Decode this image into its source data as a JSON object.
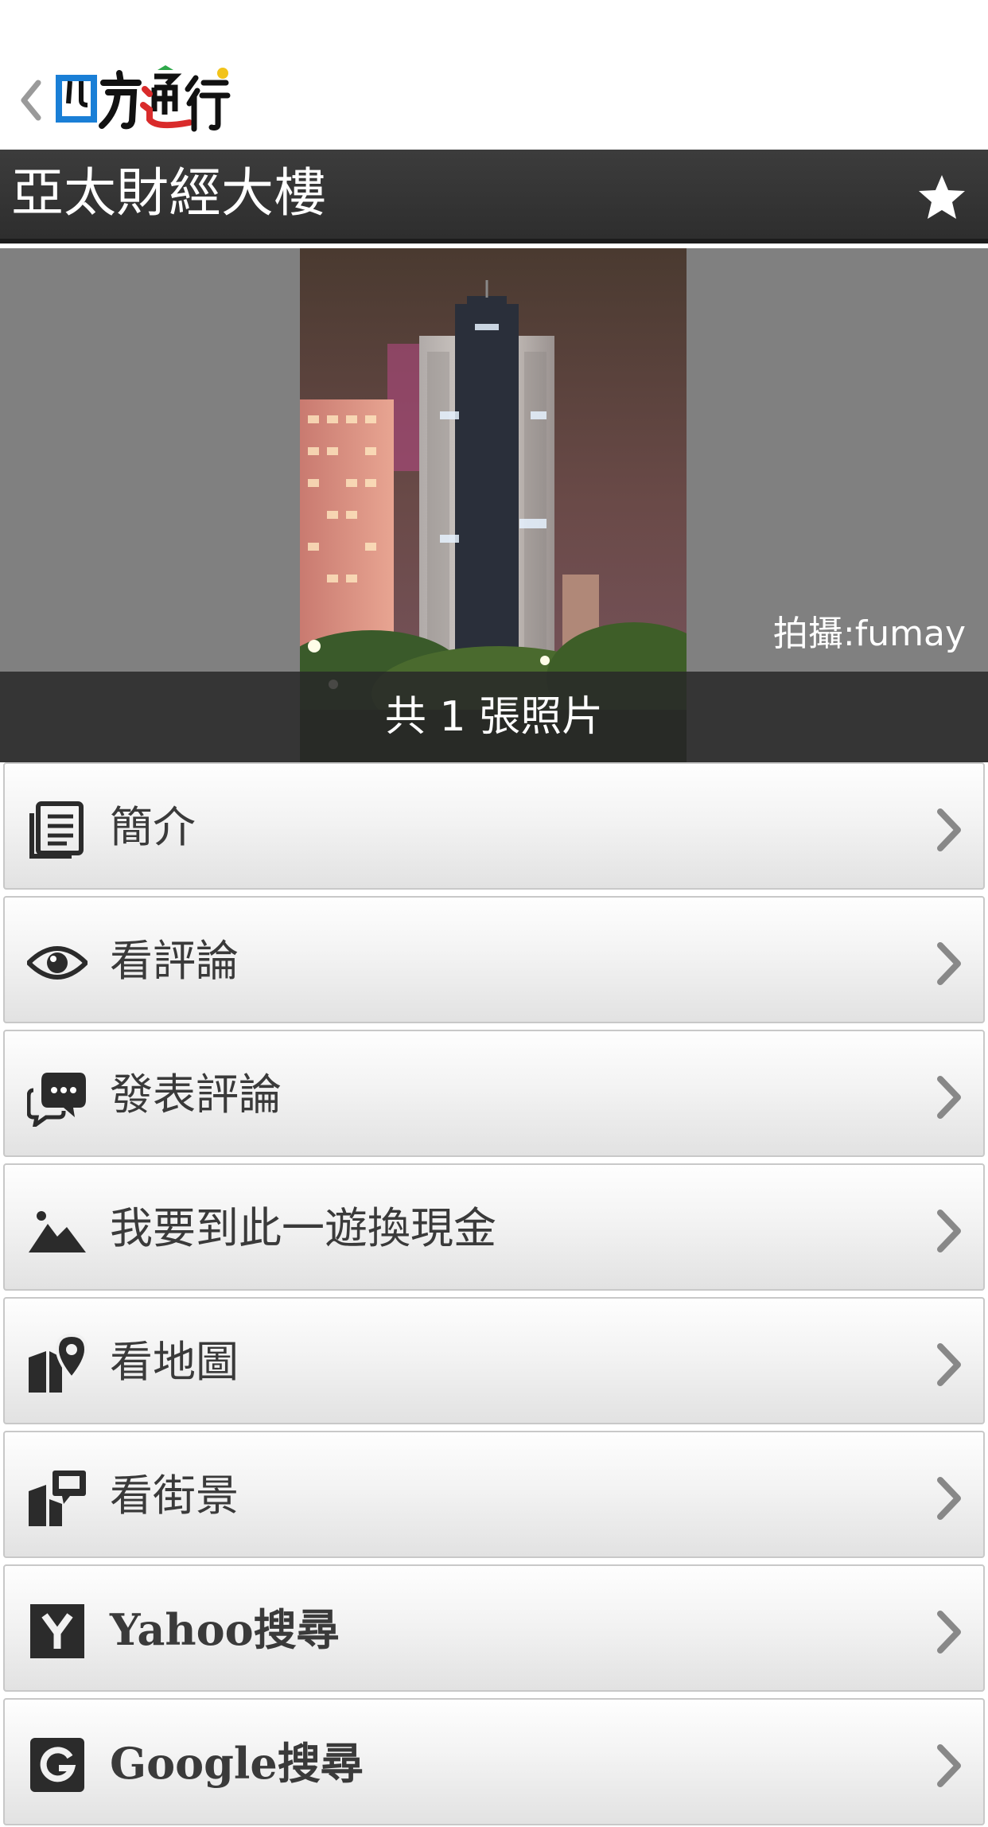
{
  "app": {
    "logo_text": "四方通行",
    "back_icon": "chevron-left-icon"
  },
  "title_bar": {
    "title": "亞太財經大樓",
    "favorite_icon": "star-icon"
  },
  "photo": {
    "credit": "拍攝:fumay",
    "count_label": "共 1 張照片"
  },
  "menu": {
    "items": [
      {
        "label": "簡介",
        "icon": "document-icon"
      },
      {
        "label": "看評論",
        "icon": "eye-icon"
      },
      {
        "label": "發表評論",
        "icon": "chat-bubbles-icon"
      },
      {
        "label": "我要到此一遊換現金",
        "icon": "mountain-landscape-icon"
      },
      {
        "label": "看地圖",
        "icon": "map-pin-icon"
      },
      {
        "label": "看街景",
        "icon": "street-view-icon"
      },
      {
        "label": "Yahoo搜尋",
        "icon": "yahoo-icon"
      },
      {
        "label": "Google搜尋",
        "icon": "google-icon"
      }
    ]
  },
  "colors": {
    "title_bar": "#333333",
    "photo_bg": "#808080",
    "menu_text": "#3a3a3a",
    "logo_blue": "#1a7fd6",
    "logo_red": "#d92b2b",
    "logo_green": "#2ea84a",
    "logo_yellow": "#f2c31a"
  }
}
